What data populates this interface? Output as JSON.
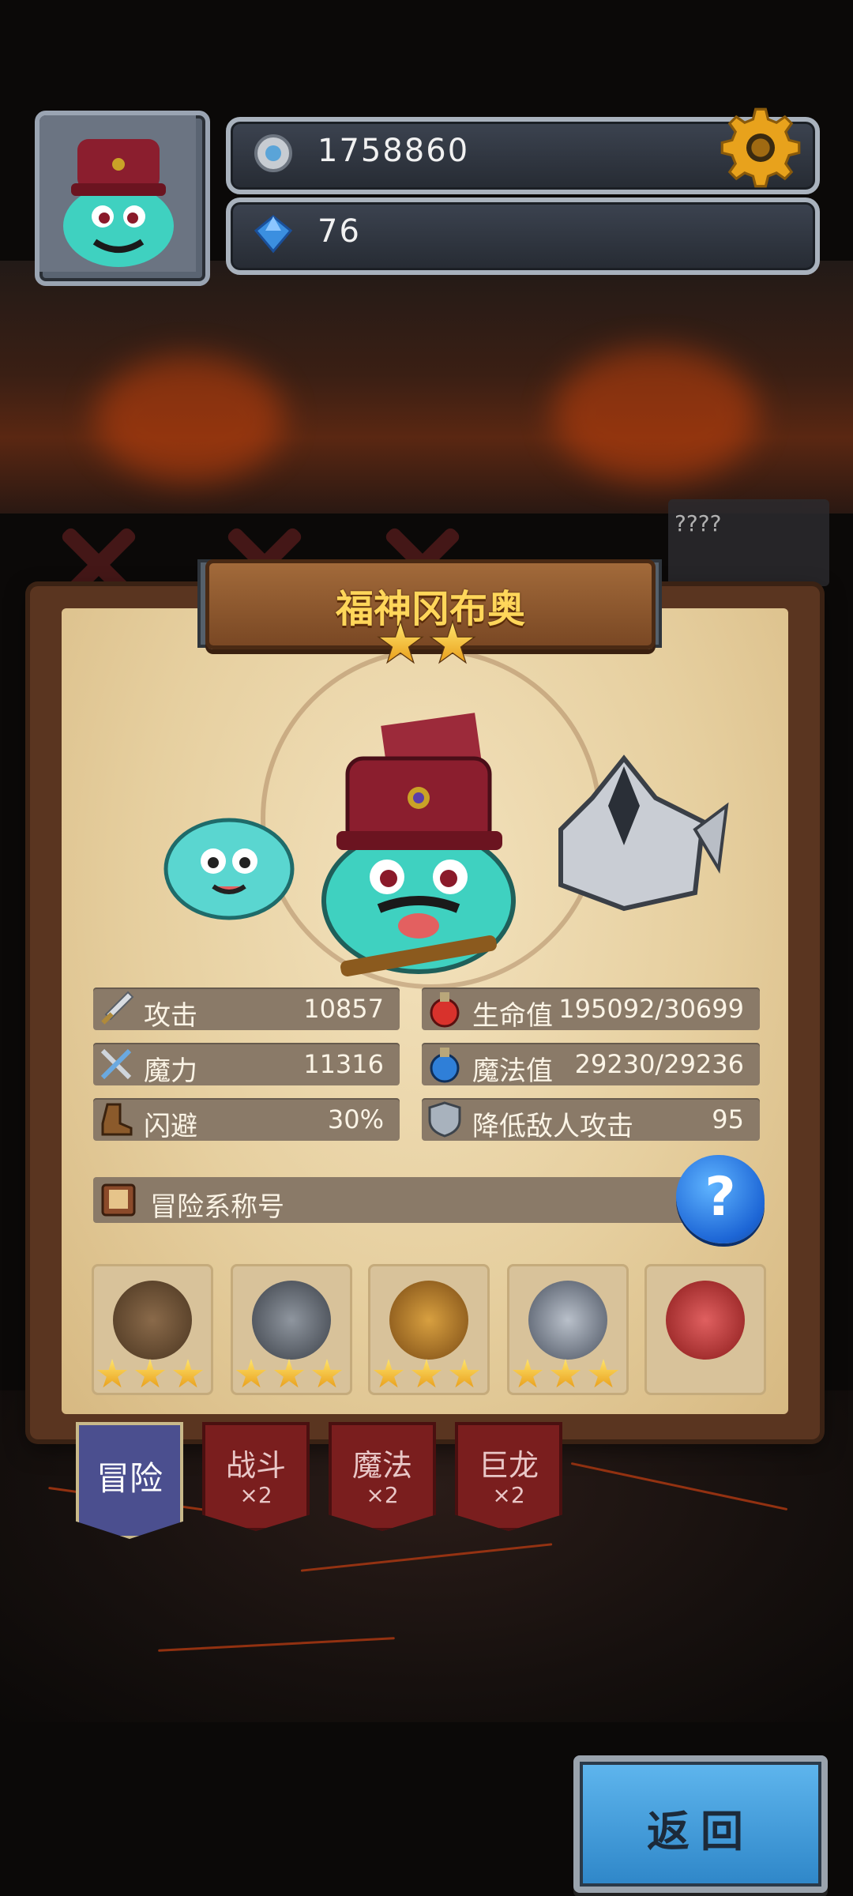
{
  "resources": {
    "coins": "1758860",
    "gems": "76"
  },
  "locked_slot": {
    "label": "????"
  },
  "hero": {
    "name": "福神冈布奥",
    "stars": 2
  },
  "stats": {
    "attack": {
      "label": "攻击",
      "value": "10857"
    },
    "hp": {
      "label": "生命值",
      "value": "195092/30699"
    },
    "magic_power": {
      "label": "魔力",
      "value": "11316"
    },
    "mp": {
      "label": "魔法值",
      "value": "29230/29236"
    },
    "dodge": {
      "label": "闪避",
      "value": "30%"
    },
    "reduce_attack": {
      "label": "降低敌人攻击",
      "value": "95"
    }
  },
  "title_row": {
    "label": "冒险系称号",
    "help": "?"
  },
  "badges": [
    {
      "icon": "telescope-badge-icon",
      "stars": 3
    },
    {
      "icon": "pickaxe-shield-badge-icon",
      "stars": 3
    },
    {
      "icon": "anvil-badge-icon",
      "stars": 3
    },
    {
      "icon": "knight-laurel-badge-icon",
      "stars": 3
    },
    {
      "icon": "crown-laurel-badge-icon",
      "stars": 0
    }
  ],
  "tabs": [
    {
      "label": "冒险",
      "mult": ""
    },
    {
      "label": "战斗",
      "mult": "×2"
    },
    {
      "label": "魔法",
      "mult": "×2"
    },
    {
      "label": "巨龙",
      "mult": "×2"
    }
  ],
  "back_button": {
    "label": "返回"
  },
  "colors": {
    "accent_gold": "#ffd65a",
    "tab_active": "#4b4f8f",
    "tab_inactive": "#7a1e1e",
    "back_button": "#3b9ada"
  }
}
